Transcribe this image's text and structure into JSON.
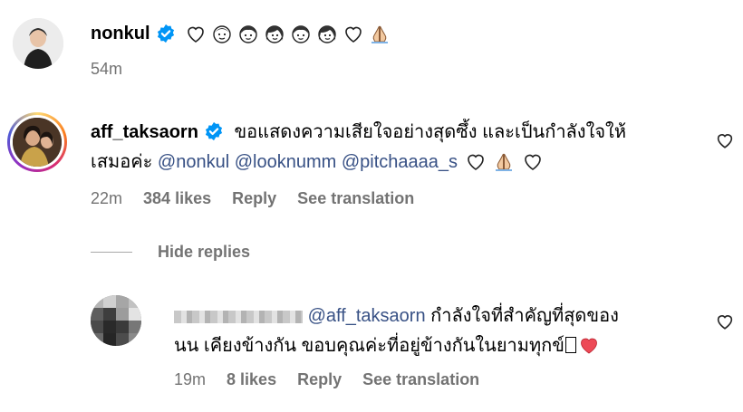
{
  "post": {
    "username": "nonkul",
    "time": "54m"
  },
  "comment": {
    "username": "aff_taksaorn",
    "text_line1": "ขอแสดงความเสียใจอย่างสุดซึ้ง และเป็นกำลังใจให้",
    "text_prefix": "เสมอค่ะ",
    "mentions": [
      "@nonkul",
      "@looknumm",
      "@pitchaaaa_s"
    ],
    "time": "22m",
    "likes": "384 likes",
    "reply": "Reply",
    "translate": "See translation"
  },
  "replies_toggle": "Hide replies",
  "reply": {
    "mention": "@aff_taksaorn",
    "text_line1": "กำลังใจที่สำคัญที่สุดของ",
    "text_line2": "นน เคียงข้างกัน ขอบคุณค่ะที่อยู่ข้างกันในยามทุกข์",
    "time": "19m",
    "likes": "8 likes",
    "reply": "Reply",
    "translate": "See translation"
  },
  "colors": {
    "link": "#385185",
    "meta": "#737373",
    "verified": "#0095f6",
    "heart": "#ed4956"
  }
}
